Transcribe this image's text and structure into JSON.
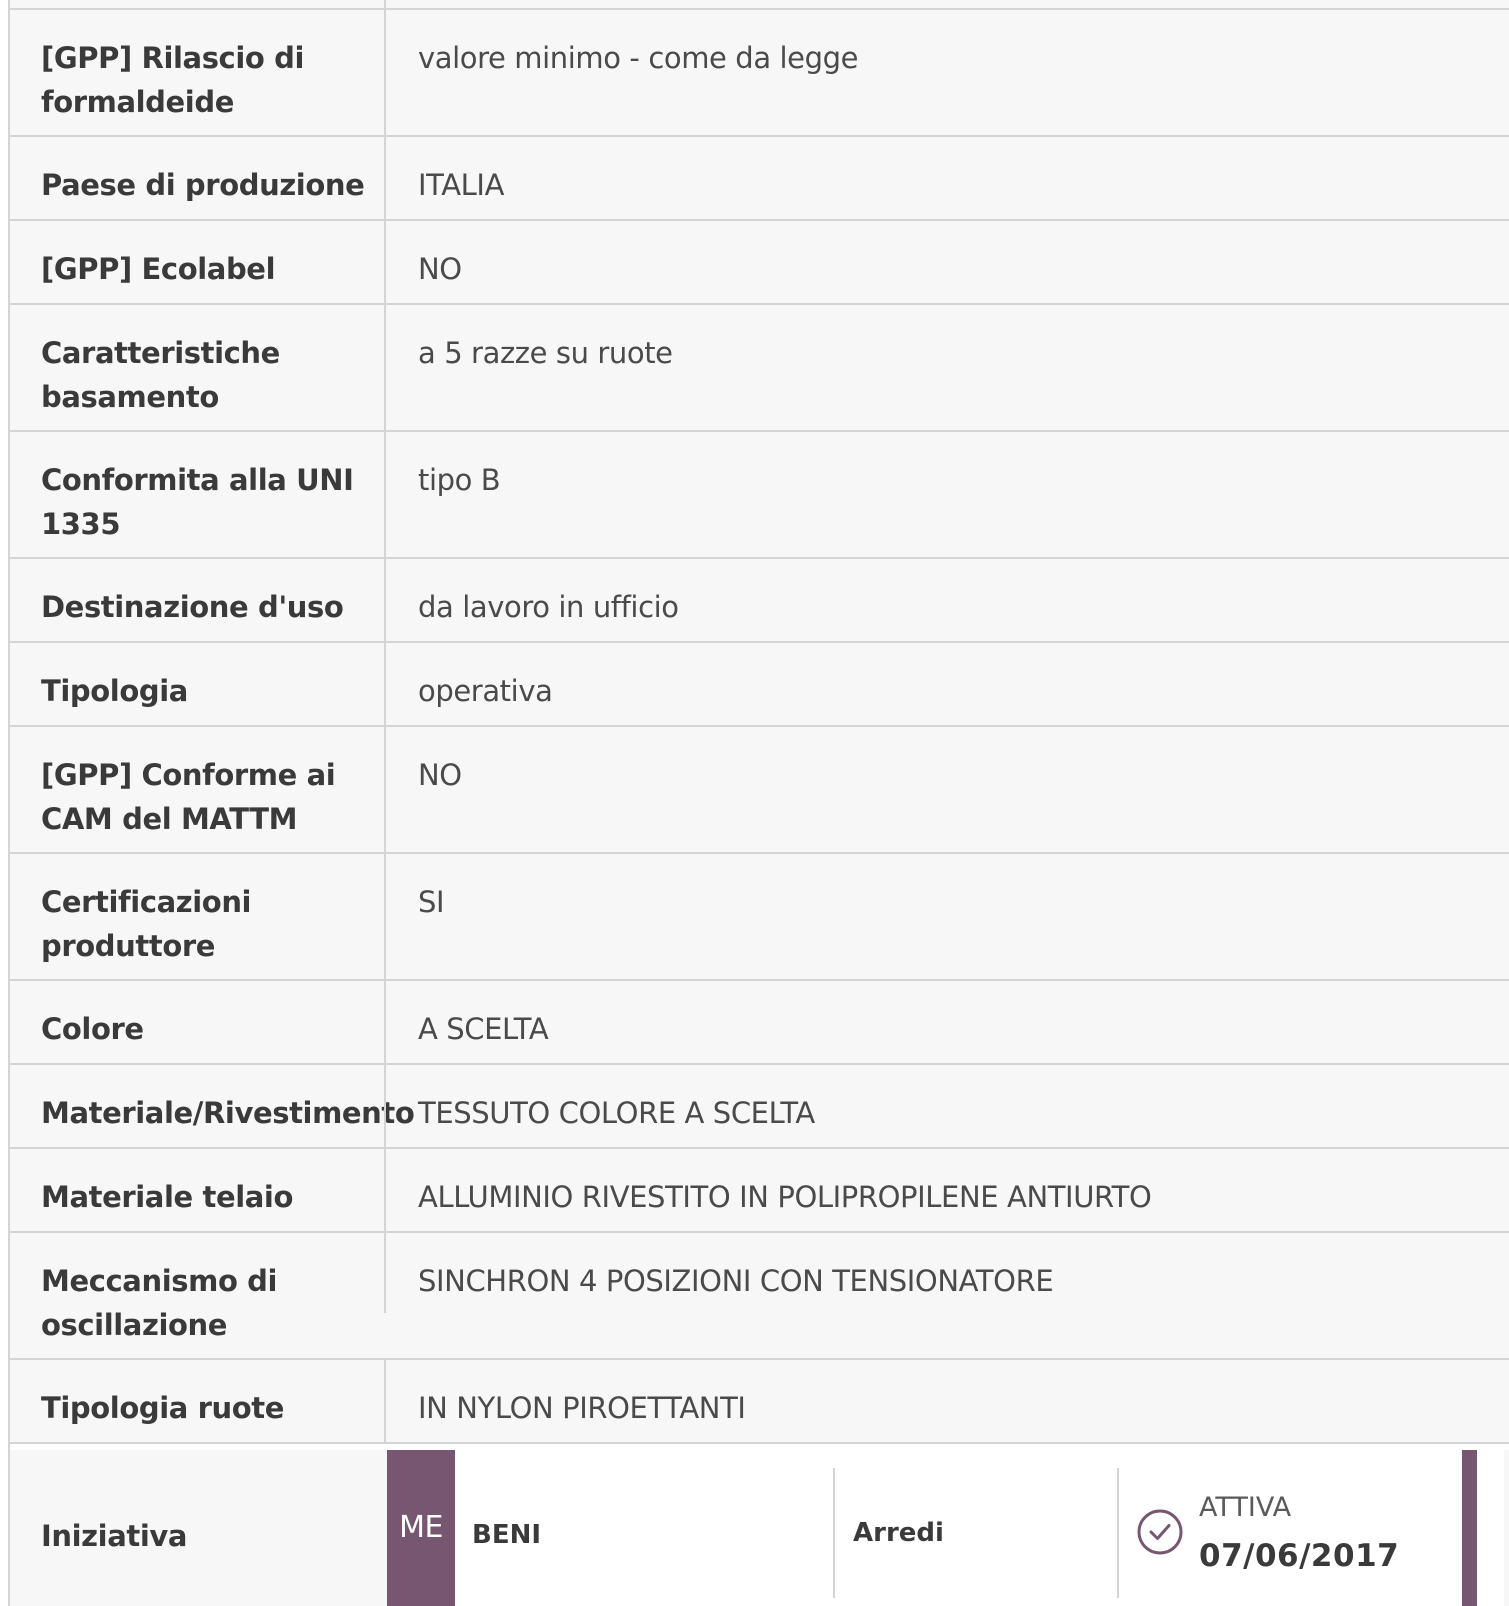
{
  "specs": [
    {
      "label": "[GPP] Rilascio di formaldeide",
      "value": "valore minimo - come da legge"
    },
    {
      "label": "Paese di produzione",
      "value": "ITALIA"
    },
    {
      "label": "[GPP] Ecolabel",
      "value": "NO"
    },
    {
      "label": "Caratteristiche basamento",
      "value": "a 5 razze su ruote"
    },
    {
      "label": "Conformita alla UNI 1335",
      "value": "tipo B"
    },
    {
      "label": "Destinazione d'uso",
      "value": "da lavoro in ufficio"
    },
    {
      "label": "Tipologia",
      "value": "operativa"
    },
    {
      "label": "[GPP] Conforme ai CAM del MATTM",
      "value": "NO"
    },
    {
      "label": "Certificazioni produttore",
      "value": "SI"
    },
    {
      "label": "Colore",
      "value": "A SCELTA"
    },
    {
      "label": "Materiale/Rivestimento",
      "value": "TESSUTO COLORE A SCELTA"
    },
    {
      "label": "Materiale telaio",
      "value": "ALLUMINIO RIVESTITO IN POLIPROPILENE ANTIURTO"
    },
    {
      "label": "Meccanismo di oscillazione",
      "value": "SINCHRON 4 POSIZIONI CON TENSIONATORE"
    },
    {
      "label": "Tipologia ruote",
      "value": "IN NYLON PIROETTANTI"
    }
  ],
  "iniziativa": {
    "label": "Iniziativa",
    "badge": "ME",
    "category": "BENI",
    "subcategory": "Arredi",
    "status": "ATTIVA",
    "date": "07/06/2017",
    "status_icon": "check-circle-icon"
  },
  "colors": {
    "accent": "#775671",
    "row_background": "#f7f7f7",
    "border": "#d4d4d4"
  }
}
